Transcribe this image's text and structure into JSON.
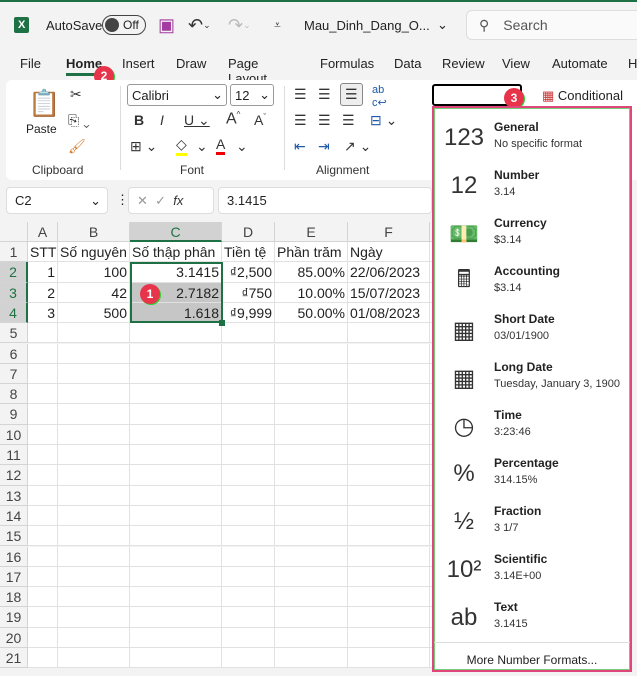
{
  "titlebar": {
    "autosave": "AutoSave",
    "toggle": "Off",
    "filename": "Mau_Dinh_Dang_O...",
    "search": "Search"
  },
  "tabs": [
    "File",
    "Home",
    "Insert",
    "Draw",
    "Page Layout",
    "Formulas",
    "Data",
    "Review",
    "View",
    "Automate",
    "H"
  ],
  "ribbon": {
    "paste": "Paste",
    "clipboard": "Clipboard",
    "font_name": "Calibri",
    "font_size": "12",
    "font": "Font",
    "alignment": "Alignment",
    "conditional": "Conditional Fo",
    "number_format_value": ""
  },
  "formula": {
    "namebox": "C2",
    "fx": "fx",
    "value": "3.1415"
  },
  "badges": [
    "1",
    "2",
    "3"
  ],
  "columns": [
    "A",
    "B",
    "C",
    "D",
    "E",
    "F"
  ],
  "rows": [
    [
      "STT",
      "Số nguyên",
      "Số thập phân",
      "Tiền tệ",
      "Phần trăm",
      "Ngày"
    ],
    [
      "1",
      "100",
      "3.1415",
      "₫2,500",
      "85.00%",
      "22/06/2023"
    ],
    [
      "2",
      "42",
      "2.7182",
      "₫750",
      "10.00%",
      "15/07/2023"
    ],
    [
      "3",
      "500",
      "1.618",
      "₫9,999",
      "50.00%",
      "01/08/2023"
    ]
  ],
  "row_count": 21,
  "formats": [
    {
      "title": "General",
      "sample": "No specific format",
      "icon": "clock-123-icon",
      "glyph": "123"
    },
    {
      "title": "Number",
      "sample": "3.14",
      "icon": "number-icon",
      "glyph": "12"
    },
    {
      "title": "Currency",
      "sample": "$3.14",
      "icon": "currency-icon",
      "glyph": "💵"
    },
    {
      "title": "Accounting",
      "sample": "$3.14",
      "icon": "accounting-icon",
      "glyph": "🖩"
    },
    {
      "title": "Short Date",
      "sample": "03/01/1900",
      "icon": "calendar-icon",
      "glyph": "▦"
    },
    {
      "title": "Long Date",
      "sample": "Tuesday, January 3, 1900",
      "icon": "calendar-large-icon",
      "glyph": "▦"
    },
    {
      "title": "Time",
      "sample": "3:23:46",
      "icon": "clock-icon",
      "glyph": "◷"
    },
    {
      "title": "Percentage",
      "sample": "314.15%",
      "icon": "percent-icon",
      "glyph": "%"
    },
    {
      "title": "Fraction",
      "sample": "3 1/7",
      "icon": "fraction-icon",
      "glyph": "½"
    },
    {
      "title": "Scientific",
      "sample": "3.14E+00",
      "icon": "scientific-icon",
      "glyph": "10²"
    },
    {
      "title": "Text",
      "sample": "3.1415",
      "icon": "text-icon",
      "glyph": "ab"
    }
  ],
  "more_formats": "More Number Formats..."
}
